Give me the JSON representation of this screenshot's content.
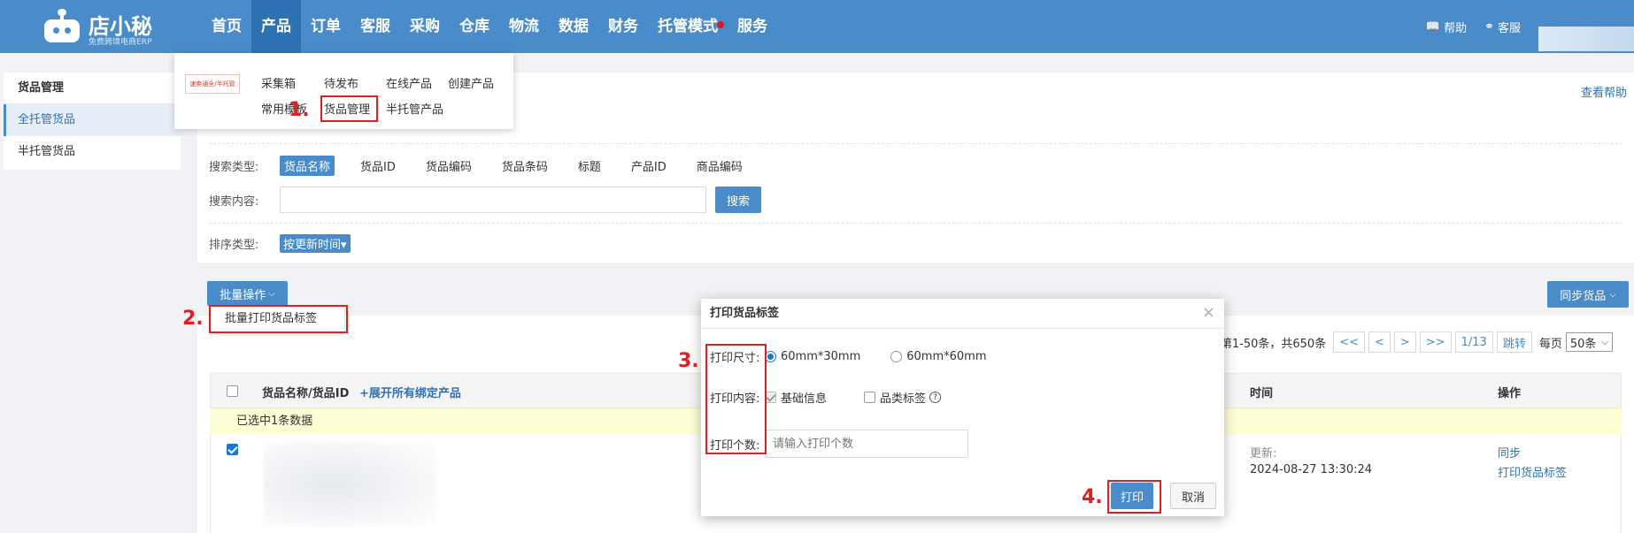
{
  "logo": {
    "name": "店小秘",
    "subtitle": "免费跨境电商ERP"
  },
  "nav": [
    {
      "label": "首页",
      "active": false
    },
    {
      "label": "产品",
      "active": true
    },
    {
      "label": "订单",
      "active": false
    },
    {
      "label": "客服",
      "active": false
    },
    {
      "label": "采购",
      "active": false
    },
    {
      "label": "仓库",
      "active": false
    },
    {
      "label": "物流",
      "active": false
    },
    {
      "label": "数据",
      "active": false
    },
    {
      "label": "财务",
      "active": false
    },
    {
      "label": "托管模式",
      "active": false,
      "dot": true
    },
    {
      "label": "服务",
      "active": false
    }
  ],
  "top_right": {
    "help": "帮助",
    "service": "客服"
  },
  "product_menu": {
    "badge": "速卖通全/半托管",
    "items": [
      "采集箱",
      "待发布",
      "在线产品",
      "创建产品",
      "常用模板",
      "货品管理",
      "半托管产品"
    ]
  },
  "sidebar": {
    "title": "货品管理",
    "items": [
      {
        "label": "全托管货品",
        "active": true
      },
      {
        "label": "半托管货品",
        "active": false
      }
    ]
  },
  "help_link": "查看帮助",
  "filters": {
    "search_type_label": "搜索类型:",
    "search_types": [
      "货品名称",
      "货品ID",
      "货品编码",
      "货品条码",
      "标题",
      "产品ID",
      "商品编码"
    ],
    "search_content_label": "搜索内容:",
    "search_button": "搜索",
    "sort_label": "排序类型:",
    "sort_value": "按更新时间▾"
  },
  "batch": {
    "button": "批量操作",
    "menu_item": "批量打印货品标签"
  },
  "sync_button": "同步货品",
  "pager": {
    "summary": "第1-50条，共650条",
    "first": "<<",
    "prev": "<",
    "next": ">",
    "last": ">>",
    "page": "1/13",
    "jump": "跳转",
    "per_page_label": "每页",
    "per_page": "50条"
  },
  "table": {
    "col_name": "货品名称/货品ID",
    "expand": "+展开所有绑定产品",
    "col_time": "时间",
    "col_action": "操作",
    "selected_notice": "已选中1条数据",
    "row": {
      "updated_label": "更新:",
      "updated_time": "2024-08-27 13:30:24",
      "action_sync": "同步",
      "action_print": "打印货品标签"
    }
  },
  "modal": {
    "title": "打印货品标签",
    "close": "×",
    "size_label": "打印尺寸:",
    "size_options": [
      "60mm*30mm",
      "60mm*60mm"
    ],
    "content_label": "打印内容:",
    "content_basic": "基础信息",
    "content_category": "品类标签",
    "count_label": "打印个数:",
    "count_placeholder": "请输入打印个数",
    "print_button": "打印",
    "cancel_button": "取消"
  },
  "annotations": [
    "1.",
    "2.",
    "3.",
    "4."
  ],
  "colors": {
    "primary": "#4a8bc9",
    "nav_active": "#2f72b3",
    "annotation_red": "#e02020"
  }
}
